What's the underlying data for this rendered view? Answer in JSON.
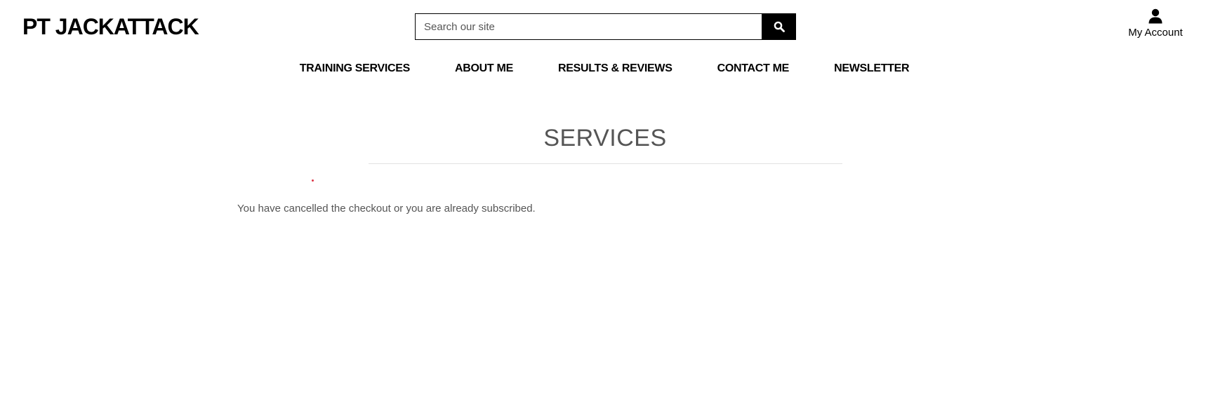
{
  "header": {
    "logo_text": "PT JACKATTACK",
    "search": {
      "placeholder": "Search our site",
      "value": "",
      "button_icon": "search-icon"
    },
    "account": {
      "icon": "user-icon",
      "label": "My Account"
    }
  },
  "nav": {
    "items": [
      {
        "label": "TRAINING SERVICES"
      },
      {
        "label": "ABOUT ME"
      },
      {
        "label": "RESULTS & REVIEWS"
      },
      {
        "label": "CONTACT ME"
      },
      {
        "label": "NEWSLETTER"
      }
    ]
  },
  "main": {
    "title": "SERVICES",
    "message": "You have cancelled the checkout or you are already subscribed."
  },
  "colors": {
    "text": "#000000",
    "muted_text": "#555555",
    "rule": "#e2e2e2",
    "accent_dot": "#dc3545",
    "button_bg": "#000000"
  }
}
